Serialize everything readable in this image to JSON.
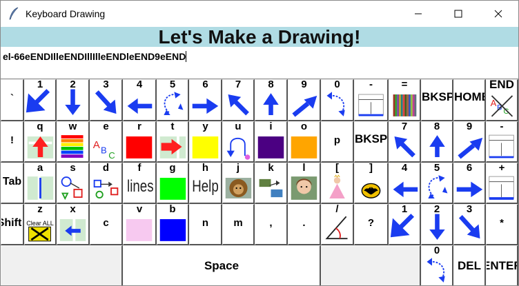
{
  "window": {
    "title": "Keyboard Drawing",
    "icon": "quill-icon",
    "controls": [
      "minimize-icon",
      "maximize-icon",
      "close-icon"
    ]
  },
  "heading": "Let's Make a Drawing!",
  "text_entry": {
    "value": "el-66eENDIlleENDIllIlleENDleEND9eEND"
  },
  "keys": {
    "r1": [
      "`",
      "1",
      "2",
      "3",
      "4",
      "5",
      "6",
      "7",
      "8",
      "9",
      "0",
      "-",
      "=",
      "BKSP",
      "HOME",
      "END"
    ],
    "r2": [
      "!",
      "q",
      "w",
      "e",
      "r",
      "t",
      "y",
      "u",
      "i",
      "o",
      "p",
      "BKSP",
      "7",
      "8",
      "9",
      "-"
    ],
    "r3": [
      "Tab",
      "a",
      "s",
      "d",
      "f",
      "g",
      "h",
      "j",
      "k",
      "l",
      "[",
      "]",
      "4",
      "5",
      "6",
      "+"
    ],
    "r4": [
      "Shift",
      "z",
      "x",
      "c",
      "v",
      "b",
      "n",
      "m",
      ",",
      ".",
      "/",
      "?",
      "1",
      "2",
      "3",
      "*"
    ],
    "r5": [
      "Space",
      "0",
      "DEL",
      "ENTER"
    ],
    "clear_all": "Clear ALL",
    "lines": "lines",
    "help": "Help"
  },
  "colors": {
    "heading_bg": "#b0dce4",
    "arrow_blue": "#1a3cf0",
    "red": "#ff0000",
    "yellow": "#ffff00",
    "green": "#00ff00",
    "purple": "#4b0082",
    "orange": "#ffa500",
    "pink": "#f7c9f0",
    "blue": "#0000ff"
  }
}
